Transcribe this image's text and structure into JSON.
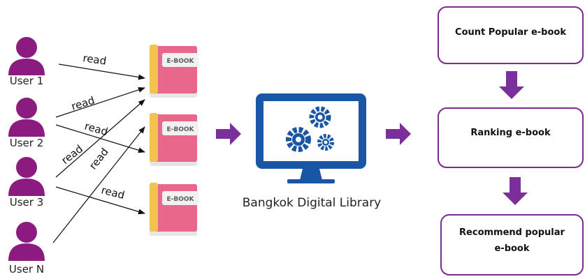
{
  "users": [
    {
      "label": "User 1"
    },
    {
      "label": "User 2"
    },
    {
      "label": "User 3"
    },
    {
      "label": "User N"
    }
  ],
  "read_label": "read",
  "book_label": "E-BOOK",
  "library_label": "Bangkok Digital Library",
  "steps": [
    {
      "line1": "Count Popular e-book",
      "line2": ""
    },
    {
      "line1": "Ranking e-book",
      "line2": ""
    },
    {
      "line1": "Recommend popular",
      "line2": "e-book"
    }
  ],
  "colors": {
    "user": "#8b1b7f",
    "book_cover": "#e8678a",
    "book_spine": "#f2c34d",
    "book_pages": "#e6e6e6",
    "monitor": "#1a56a6",
    "arrow": "#7b2f9a",
    "box_border": "#7a2c8c"
  },
  "icons": [
    "user-icon",
    "ebook-icon",
    "computer-gears-icon",
    "arrow-right-icon",
    "arrow-down-icon"
  ]
}
